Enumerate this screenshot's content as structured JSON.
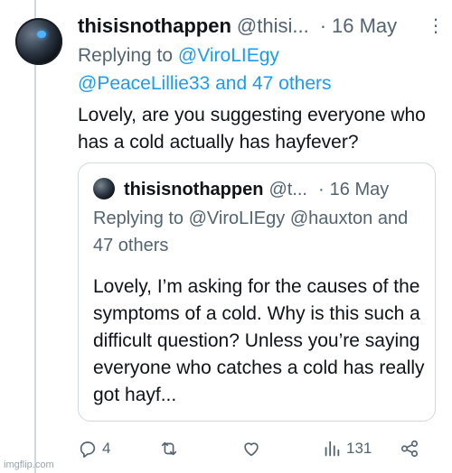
{
  "tweet": {
    "display_name": "thisisnothappen",
    "handle": "@thisi...",
    "separator": "·",
    "date": "16 May",
    "more_icon": "more-icon",
    "replying_prefix": "Replying to",
    "replying_user1": "@ViroLIEgy",
    "replying_user2": "@PeaceLillie33",
    "replying_others": "and 47 others",
    "text": "Lovely, are you suggesting everyone who has a cold actually has hayfever?"
  },
  "quoted": {
    "display_name": "thisisnothappen",
    "handle": "@t...",
    "separator": "·",
    "date": "16 May",
    "replying_line": "Replying to @ViroLIEgy @hauxton and 47 others",
    "text": "Lovely, I’m asking for the causes of the symptoms of a cold. Why is this such a difficult question? Unless you’re saying everyone who catches a cold has really got hayf..."
  },
  "actions": {
    "reply_count": "4",
    "retweet_count": "",
    "like_count": "",
    "views_count": "131"
  },
  "colors": {
    "link": "#1d9bf0",
    "muted": "#536471",
    "text": "#0f1419",
    "border": "#cfd9de"
  },
  "watermark": "imgflip.com"
}
